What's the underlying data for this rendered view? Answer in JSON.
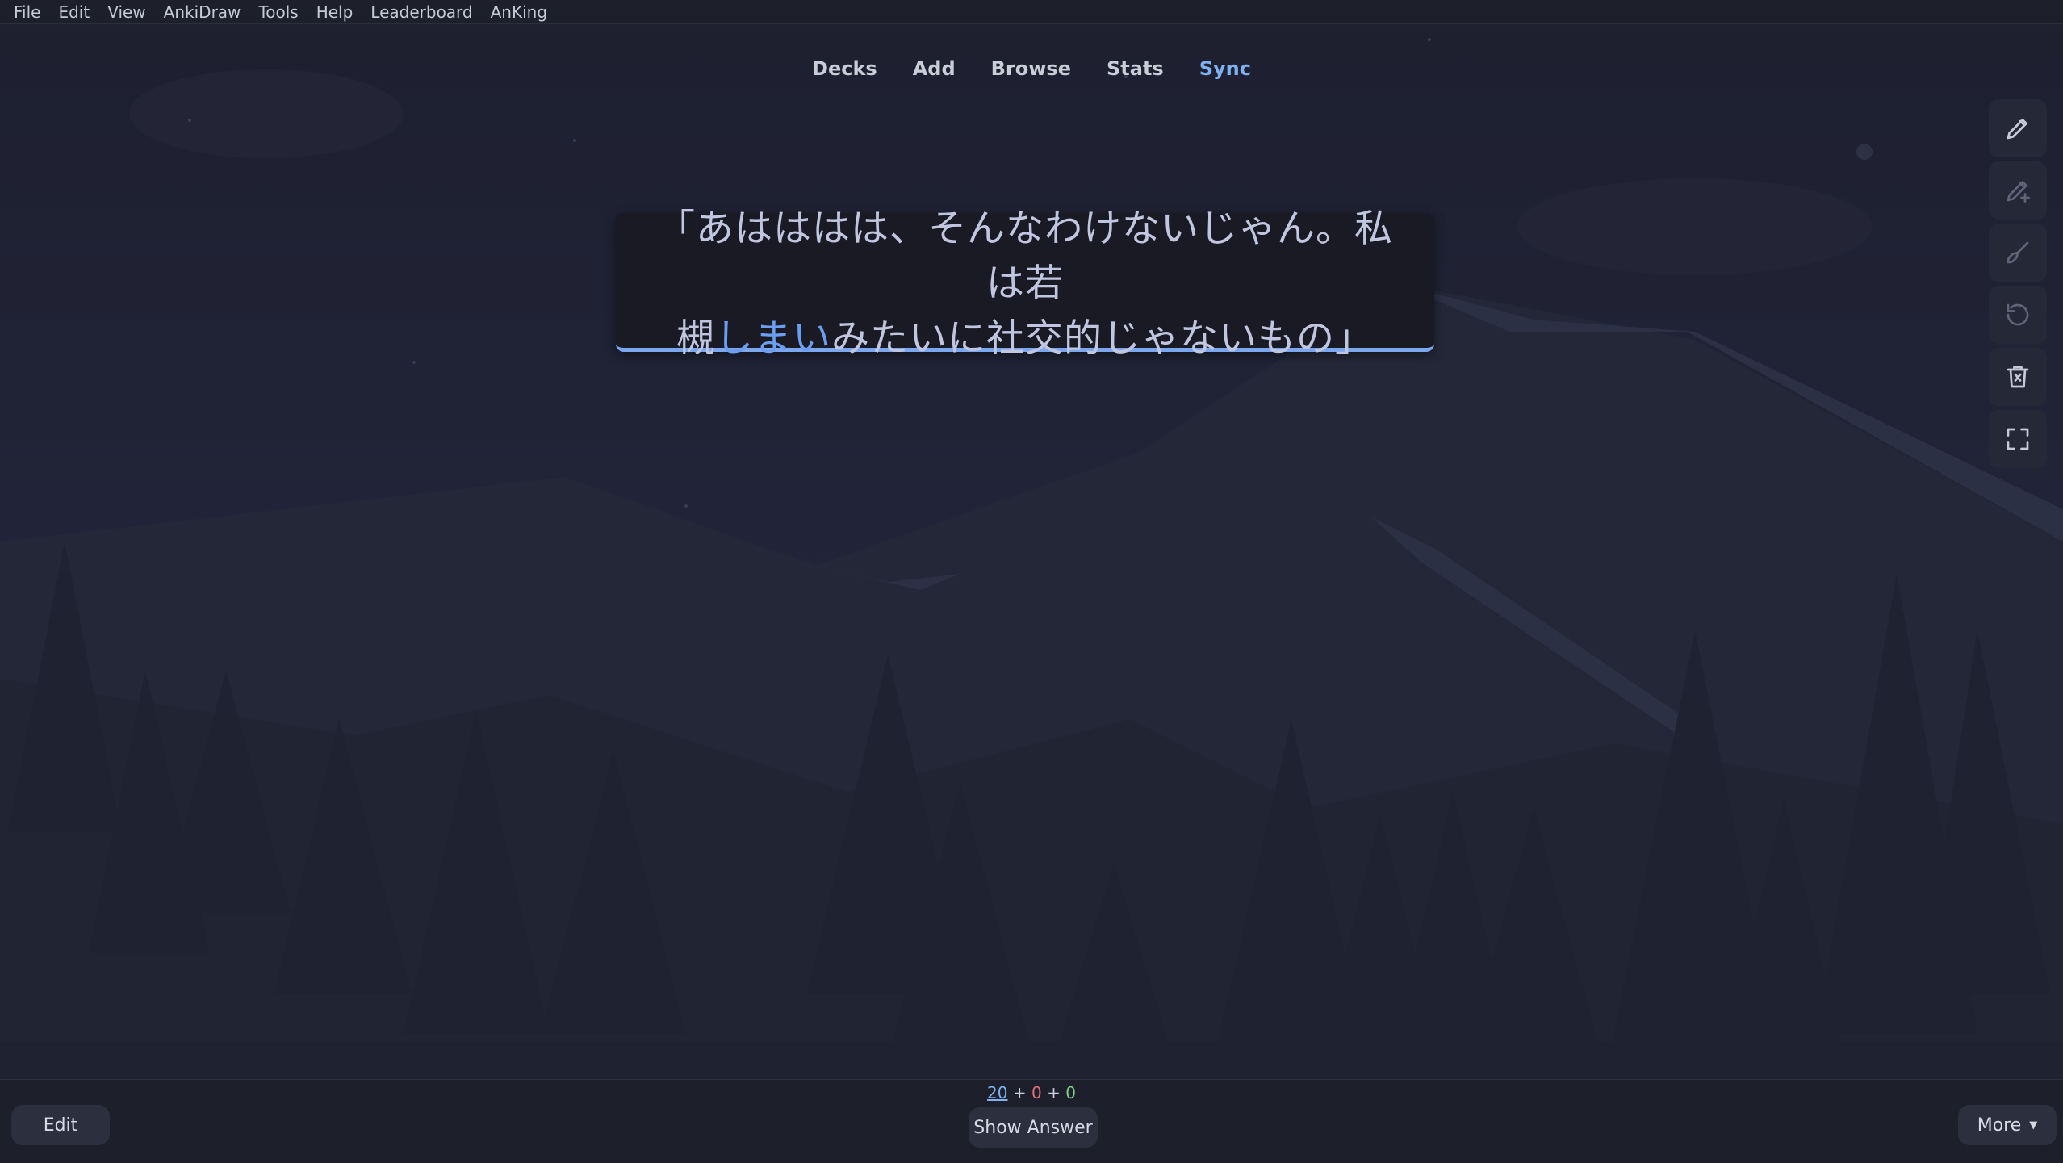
{
  "menubar": {
    "items": [
      "File",
      "Edit",
      "View",
      "AnkiDraw",
      "Tools",
      "Help",
      "Leaderboard",
      "AnKing"
    ]
  },
  "nav": {
    "decks": "Decks",
    "add": "Add",
    "browse": "Browse",
    "stats": "Stats",
    "sync": "Sync"
  },
  "card": {
    "line1": "「あはははは、そんなわけないじゃん。私は若",
    "line2_before": "槻",
    "line2_highlight": "しまい",
    "line2_after": "みたいに社交的じゃないもの」"
  },
  "tools": {
    "items": [
      "pencil-icon",
      "pencil-plus-icon",
      "brush-icon",
      "undo-icon",
      "trash-icon",
      "fullscreen-icon"
    ]
  },
  "bottom": {
    "edit_label": "Edit",
    "show_answer_label": "Show Answer",
    "more_label": "More",
    "counts": {
      "new": "20",
      "sep1": " + ",
      "learn": "0",
      "sep2": " + ",
      "review": "0"
    }
  },
  "colors": {
    "background": "#1f2130",
    "accent": "#7aa7ee",
    "new_count": "#7fb1f0",
    "learn_count": "#e0707a",
    "review_count": "#7fd08a"
  }
}
